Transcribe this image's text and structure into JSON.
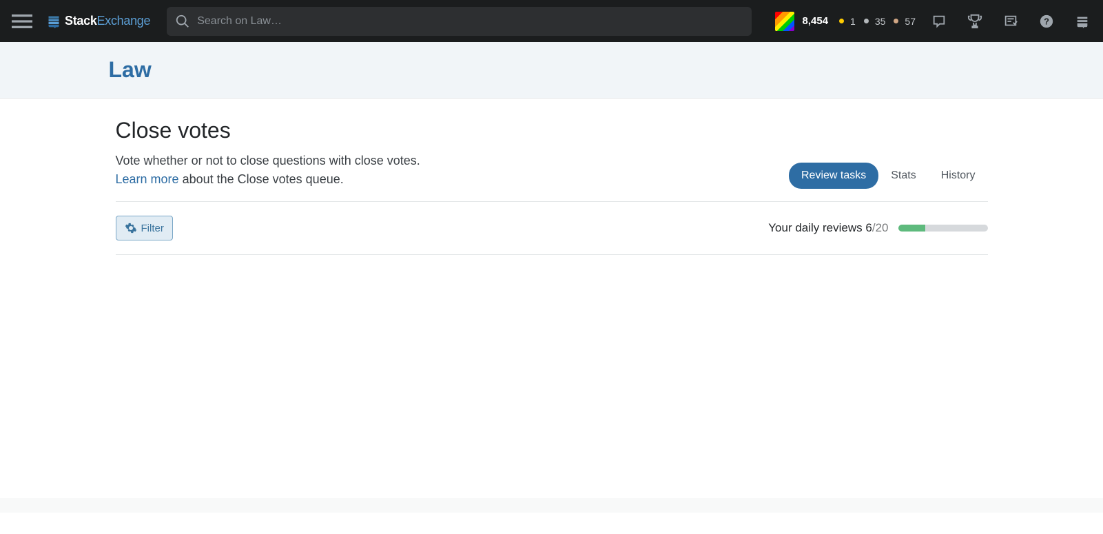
{
  "topbar": {
    "logo_prefix": "Stack",
    "logo_suffix": "Exchange",
    "search_placeholder": "Search on Law…",
    "reputation": "8,454",
    "gold_count": "1",
    "silver_count": "35",
    "bronze_count": "57"
  },
  "subheader": {
    "site_title": "Law"
  },
  "page": {
    "title": "Close votes",
    "description": "Vote whether or not to close questions with close votes.",
    "learn_more": "Learn more",
    "learn_suffix": " about the Close votes queue.",
    "tabs": {
      "review": "Review tasks",
      "stats": "Stats",
      "history": "History"
    },
    "filter_label": "Filter",
    "progress": {
      "label_prefix": "Your daily reviews ",
      "current": "6",
      "sep": "/",
      "max": "20",
      "percent": 30
    }
  }
}
